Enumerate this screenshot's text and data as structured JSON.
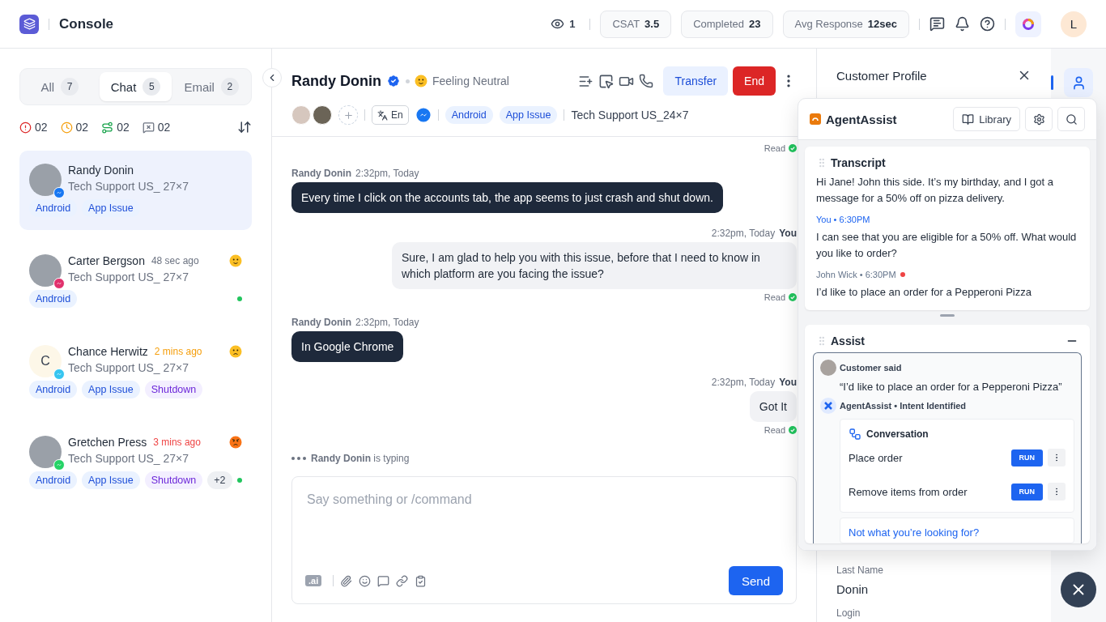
{
  "app": {
    "title": "Console"
  },
  "top_bar": {
    "viewers": "1",
    "stats": [
      {
        "label": "CSAT",
        "value": "3.5"
      },
      {
        "label": "Completed",
        "value": "23"
      },
      {
        "label": "Avg Response",
        "value": "12sec"
      }
    ],
    "user_initial": "L"
  },
  "sidebar": {
    "tabs": [
      {
        "label": "All",
        "count": "7",
        "selected": false
      },
      {
        "label": "Chat",
        "count": "5",
        "selected": true
      },
      {
        "label": "Email",
        "count": "2",
        "selected": false
      }
    ],
    "filters": [
      {
        "kind": "alert",
        "count": "02"
      },
      {
        "kind": "pending",
        "count": "02"
      },
      {
        "kind": "transferred",
        "count": "02"
      },
      {
        "kind": "closed",
        "count": "02"
      }
    ],
    "conversations": [
      {
        "name": "Randy Donin",
        "queue": "Tech Support US_ 27×7",
        "channel": {
          "kind": "messenger"
        },
        "selected": true,
        "online": false,
        "tags": [
          {
            "label": "Android",
            "kind": "platform"
          },
          {
            "label": "App Issue",
            "kind": "platform"
          }
        ]
      },
      {
        "name": "Carter Bergson",
        "time": {
          "text": "48 sec ago",
          "color": "#6b7280"
        },
        "mood": {
          "kind": "neutral"
        },
        "queue": "Tech Support US_ 27×7",
        "channel": {
          "kind": "instagram"
        },
        "selected": false,
        "online": true,
        "tags": [
          {
            "label": "Android",
            "kind": "platform"
          }
        ]
      },
      {
        "name": "Chance Herwitz",
        "initial": "C",
        "time": {
          "text": "2 mins ago",
          "color": "#f59e0b"
        },
        "mood": {
          "kind": "sad"
        },
        "queue": "Tech Support US_ 27×7",
        "channel": {
          "kind": "slack"
        },
        "selected": false,
        "online": false,
        "tags": [
          {
            "label": "Android",
            "kind": "platform"
          },
          {
            "label": "App Issue",
            "kind": "platform"
          },
          {
            "label": "Shutdown",
            "kind": "category"
          }
        ]
      },
      {
        "name": "Gretchen Press",
        "time": {
          "text": "3 mins ago",
          "color": "#ef4444"
        },
        "mood": {
          "kind": "angry"
        },
        "queue": "Tech Support US_ 27×7",
        "channel": {
          "kind": "whatsapp"
        },
        "selected": false,
        "online": true,
        "tags": [
          {
            "label": "Android",
            "kind": "platform"
          },
          {
            "label": "App Issue",
            "kind": "platform"
          },
          {
            "label": "Shutdown",
            "kind": "category"
          },
          {
            "label": "+2",
            "kind": "more"
          }
        ]
      }
    ]
  },
  "chat": {
    "name": "Randy Donin",
    "verified": true,
    "mood": {
      "kind": "neutral"
    },
    "mood_label": "Feeling Neutral",
    "transfer_label": "Transfer",
    "end_label": "End",
    "language": "En",
    "channel": {
      "kind": "messenger"
    },
    "tags": [
      {
        "label": "Android",
        "kind": "platform"
      },
      {
        "label": "App Issue",
        "kind": "platform"
      }
    ],
    "queue": "Tech Support US_24×7",
    "messages": [
      {
        "kind": "receipt",
        "status": "Read"
      },
      {
        "kind": "incoming",
        "sender": "Randy Donin",
        "time": "2:32pm, Today",
        "text": "Every time I click on the accounts tab, the app seems to just crash and shut down."
      },
      {
        "kind": "outgoing",
        "sender": "You",
        "time": "2:32pm, Today",
        "text": "Sure, I am glad to help you with this issue, before that I need to know in which platform are you facing the issue?",
        "status": "Read"
      },
      {
        "kind": "incoming",
        "sender": "Randy Donin",
        "time": "2:32pm, Today",
        "text": "In Google Chrome"
      },
      {
        "kind": "outgoing",
        "sender": "You",
        "time": "2:32pm, Today",
        "text": "Got It",
        "status": "Read"
      }
    ],
    "typing": {
      "name": "Randy Donin",
      "suffix": "is typing"
    },
    "composer": {
      "placeholder": "Say something or /command",
      "ai_badge": ".ai",
      "send_label": "Send"
    }
  },
  "profile": {
    "title": "Customer Profile",
    "fields": [
      {
        "label": "Last Name",
        "value": "Donin"
      },
      {
        "label": "Login"
      }
    ]
  },
  "agent_assist": {
    "title": "AgentAssist",
    "library_label": "Library",
    "transcript": {
      "title": "Transcript",
      "entries": [
        {
          "text": "Hi Jane! John this side. It’s my birthday, and I got a message for a 50% off on pizza delivery."
        },
        {
          "meta": "You • 6:30PM",
          "kind": "agent",
          "unread": false,
          "text": "I can see that you are eligible for a 50% off. What would you like to order?"
        },
        {
          "meta": "John Wick • 6:30PM",
          "kind": "customer",
          "unread": true,
          "text": "I’d like to place an order for a Pepperoni Pizza"
        }
      ]
    },
    "assist": {
      "title": "Assist",
      "expanded": true,
      "customer_label": "Customer said",
      "quote": "“I’d like to place an order for a Pepperoni Pizza”",
      "intent_label": "AgentAssist • Intent Identified",
      "flow_title": "Conversation",
      "actions": [
        {
          "label": "Place order",
          "button": "RUN"
        },
        {
          "label": "Remove items from order",
          "button": "RUN"
        }
      ],
      "fallback": "Not what you’re looking for?"
    }
  }
}
